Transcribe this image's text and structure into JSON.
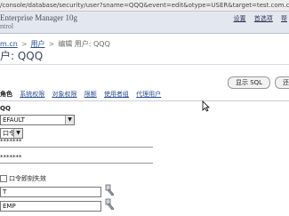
{
  "browser": {
    "url": "/console/database/security/user?sname=QQQ&event=edit&otype=USER&target=test.com.cn&type=oracle_database"
  },
  "header": {
    "brand": "Enterprise Manager 10g",
    "brand_sub": "ntrol",
    "links": [
      "设置",
      "首选项",
      "帮"
    ]
  },
  "breadcrumb": {
    "items": [
      "m.cn",
      "用户"
    ],
    "current": "编辑 用户: QQQ"
  },
  "page": {
    "title": "户: QQQ"
  },
  "actions": {
    "show_sql": "显示 SQL",
    "revert": "还原"
  },
  "tabs": [
    {
      "label": "角色",
      "active": true
    },
    {
      "label": "系统权限",
      "active": false
    },
    {
      "label": "对象权限",
      "active": false
    },
    {
      "label": "限额",
      "active": false
    },
    {
      "label": "使用者组",
      "active": false
    },
    {
      "label": "代理用户",
      "active": false
    }
  ],
  "form": {
    "name_value": "QQ",
    "profile_value": "EFAULT",
    "auth_value": "口令",
    "password_mask": "*******",
    "confirm_mask": "*******",
    "expire_label": "口令即刻失效",
    "default_tablespace": "T",
    "temp_tablespace": "EMP"
  }
}
